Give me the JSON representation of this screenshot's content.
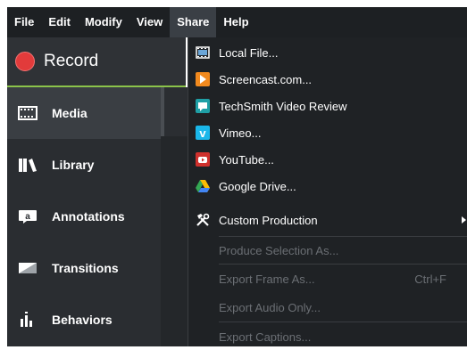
{
  "menubar": {
    "items": [
      "File",
      "Edit",
      "Modify",
      "View",
      "Share",
      "Help"
    ],
    "active": "Share"
  },
  "record": {
    "label": "Record"
  },
  "nav": {
    "items": [
      {
        "label": "Media",
        "icon": "film-icon",
        "selected": true
      },
      {
        "label": "Library",
        "icon": "library-icon",
        "selected": false
      },
      {
        "label": "Annotations",
        "icon": "annotation-icon",
        "selected": false
      },
      {
        "label": "Transitions",
        "icon": "transition-icon",
        "selected": false
      },
      {
        "label": "Behaviors",
        "icon": "behaviors-icon",
        "selected": false
      }
    ]
  },
  "share_menu": {
    "items": [
      {
        "label": "Local File...",
        "icon": "local-file-icon",
        "enabled": true
      },
      {
        "label": "Screencast.com...",
        "icon": "screencast-icon",
        "enabled": true
      },
      {
        "label": "TechSmith Video Review",
        "icon": "techsmith-review-icon",
        "enabled": true
      },
      {
        "label": "Vimeo...",
        "icon": "vimeo-icon",
        "enabled": true
      },
      {
        "label": "YouTube...",
        "icon": "youtube-icon",
        "enabled": true
      },
      {
        "label": "Google Drive...",
        "icon": "google-drive-icon",
        "enabled": true
      },
      {
        "label": "Custom Production",
        "icon": "tools-icon",
        "enabled": true,
        "submenu": true
      },
      {
        "label": "Produce Selection As...",
        "enabled": false
      },
      {
        "label": "Export Frame As...",
        "enabled": false,
        "shortcut": "Ctrl+F"
      },
      {
        "label": "Export Audio Only...",
        "enabled": false
      },
      {
        "label": "Export Captions...",
        "enabled": false
      }
    ]
  },
  "colors": {
    "accent_green": "#8bc34a",
    "record_red": "#e23b3b",
    "menu_bg": "#1f2225",
    "disabled_text": "#6b6f74"
  }
}
